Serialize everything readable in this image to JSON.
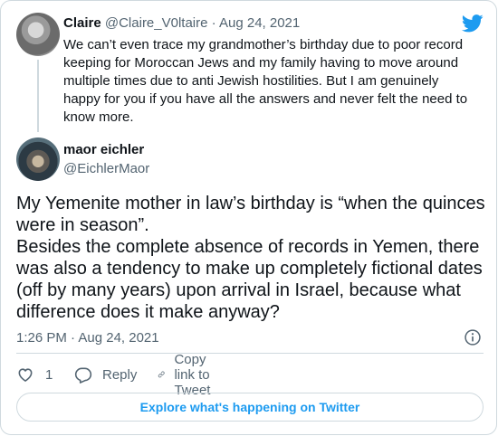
{
  "parent": {
    "name": "Claire",
    "handle": "@Claire_V0ltaire",
    "separator": "·",
    "date": "Aug 24, 2021",
    "text": "We can’t even trace my grandmother’s birthday due to poor record keeping for Moroccan Jews and my family having to move around multiple times due to anti Jewish hostilities. But I am genuinely happy for you if you have all the answers and never felt the need to know more."
  },
  "tweet": {
    "name": "maor eichler",
    "handle": "@EichlerMaor",
    "text": "My Yemenite mother in law’s birthday is “when the quinces were in season”.\nBesides the complete absence of records in Yemen, there was also a tendency to make up completely fictional dates (off by many years) upon arrival in Israel, because what difference does it make anyway?",
    "timestamp": "1:26 PM · Aug 24, 2021"
  },
  "actions": {
    "like_count": "1",
    "reply_label": "Reply",
    "copy_label": "Copy link to Tweet"
  },
  "explore_label": "Explore what's happening on Twitter",
  "colors": {
    "brand": "#1d9bf0",
    "muted": "#536471",
    "border": "#cfd9de"
  },
  "icons": [
    "twitter-logo-icon",
    "info-icon",
    "heart-icon",
    "reply-icon",
    "link-icon"
  ]
}
